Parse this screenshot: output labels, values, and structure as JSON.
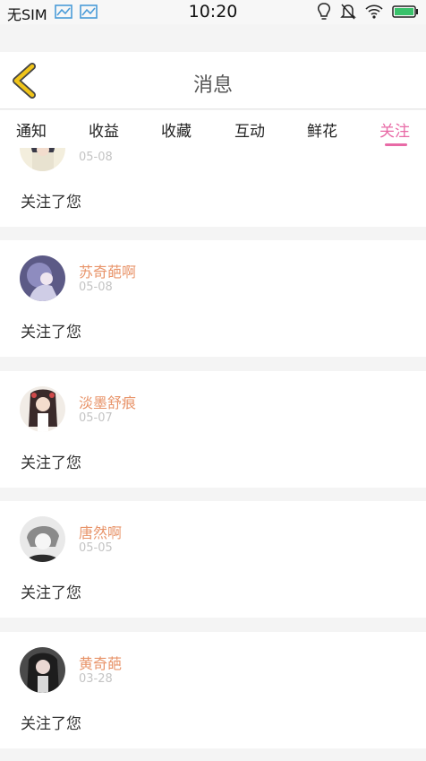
{
  "status_bar": {
    "carrier": "无SIM",
    "time": "10:20"
  },
  "header": {
    "title": "消息"
  },
  "tabs": [
    {
      "label": "通知",
      "active": false
    },
    {
      "label": "收益",
      "active": false
    },
    {
      "label": "收藏",
      "active": false
    },
    {
      "label": "互动",
      "active": false
    },
    {
      "label": "鲜花",
      "active": false
    },
    {
      "label": "关注",
      "active": true
    }
  ],
  "colors": {
    "accent": "#e86aa6",
    "username": "#e8946a",
    "back_arrow": "#f0c419"
  },
  "notifications": [
    {
      "username": "",
      "date": "05-08",
      "message": "关注了您"
    },
    {
      "username": "苏奇葩啊",
      "date": "05-08",
      "message": "关注了您"
    },
    {
      "username": "淡墨舒痕",
      "date": "05-07",
      "message": "关注了您"
    },
    {
      "username": "唐然啊",
      "date": "05-05",
      "message": "关注了您"
    },
    {
      "username": "黄奇葩",
      "date": "03-28",
      "message": "关注了您"
    }
  ]
}
